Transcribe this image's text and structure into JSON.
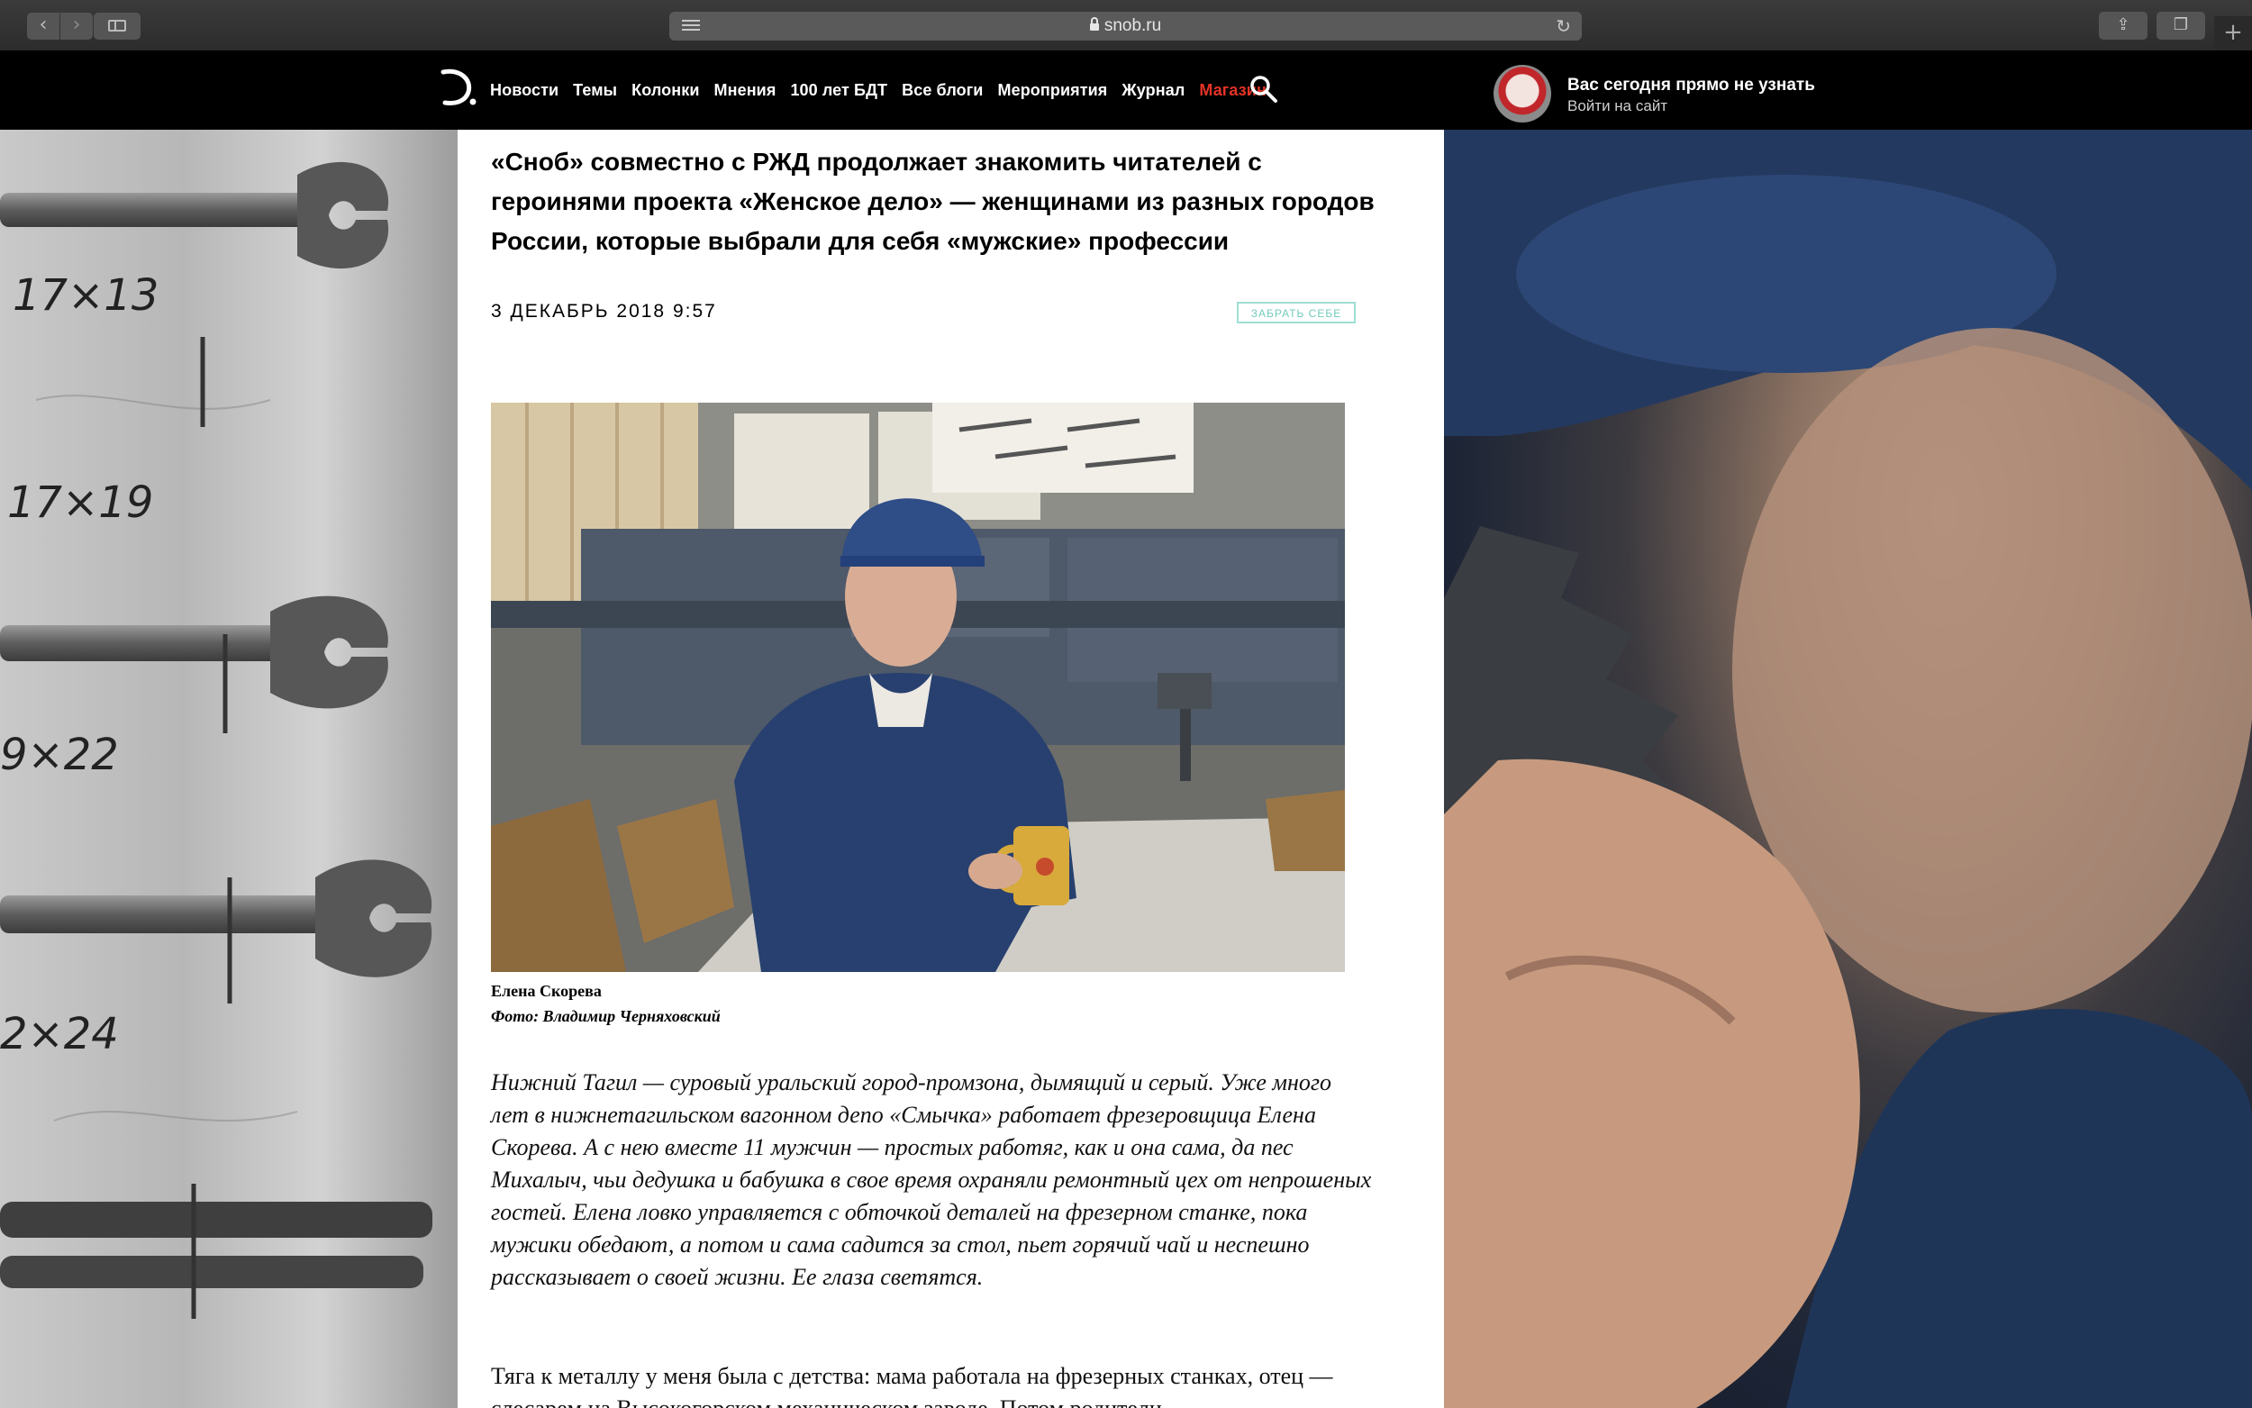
{
  "browser": {
    "url": "snob.ru",
    "back_glyph": "‹",
    "forward_glyph": "›",
    "reload_glyph": "↻",
    "share_glyph": "⇪",
    "tabs_glyph": "❐",
    "newtab_glyph": "+"
  },
  "header": {
    "logo_icon": "snob-logo-icon",
    "menu": [
      {
        "label": "Новости"
      },
      {
        "label": "Темы"
      },
      {
        "label": "Колонки"
      },
      {
        "label": "Мнения"
      },
      {
        "label": "100 лет БДТ"
      },
      {
        "label": "Все блоги"
      },
      {
        "label": "Мероприятия"
      },
      {
        "label": "Журнал"
      },
      {
        "label": "Магазин",
        "color": "#e53326"
      }
    ],
    "user": {
      "line1": "Вас сегодня прямо не узнать",
      "line2": "Войти на сайт"
    }
  },
  "article": {
    "lead": "«Сноб» совместно с РЖД продолжает знакомить читателей с героинями проекта «Женское дело» — женщинами из разных городов России, которые выбрали для себя «мужские» профессии",
    "date": "3 ДЕКАБРЬ 2018 9:57",
    "save_label": "ЗАБРАТЬ СЕБЕ",
    "caption_name": "Елена Скорева",
    "caption_photo": "Фото: Владимир Черняховский",
    "intro": "Нижний Тагил — суровый уральский город-промзона, дымящий и серый. Уже много лет в нижнетагильском вагонном депо «Смычка» работает фрезеровщица Елена Скорева. А с нею вместе 11 мужчин — простых работяг, как и она сама, да пес Михалыч, чьи дедушка и бабушка в свое время охраняли ремонтный цех от непрошеных гостей. Елена ловко управляется с обточкой деталей на фрезерном станке, пока мужики обедают, а потом и сама садится за стол, пьет горячий чай и неспешно рассказывает о своей жизни. Ее глаза светятся.",
    "body": "Тяга к металлу у меня была с детства: мама работала на фрезерных станках, отец — слесарем на Высокогорском механическом заводе. Потом родители"
  },
  "colors": {
    "brand_red": "#e53326",
    "save_accent": "#73cbbb"
  }
}
